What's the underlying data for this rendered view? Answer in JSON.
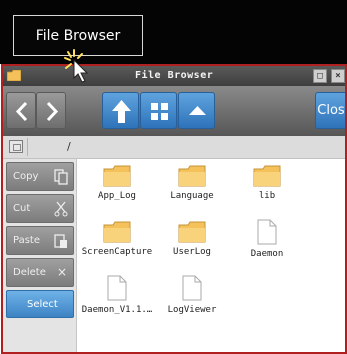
{
  "tooltip": {
    "label": "File Browser"
  },
  "window": {
    "title": "File Browser",
    "minimize_glyph": "□",
    "close_glyph": "×"
  },
  "toolbar": {
    "back_icon": "chevron-left-icon",
    "forward_icon": "chevron-right-icon",
    "up_icon": "arrow-up-icon",
    "view_icon": "grid-view-icon",
    "collapse_icon": "triangle-up-icon",
    "close_label": "Close"
  },
  "path": {
    "value": "/"
  },
  "sidebar": {
    "copy_label": "Copy",
    "cut_label": "Cut",
    "paste_label": "Paste",
    "delete_label": "Delete",
    "delete_glyph": "×",
    "select_label": "Select"
  },
  "files": [
    {
      "name": "App_Log",
      "type": "folder"
    },
    {
      "name": "Language",
      "type": "folder"
    },
    {
      "name": "lib",
      "type": "folder"
    },
    {
      "name": "ScreenCapture",
      "type": "folder"
    },
    {
      "name": "UserLog",
      "type": "folder"
    },
    {
      "name": "Daemon",
      "type": "file"
    },
    {
      "name": "Daemon_V1.1.…",
      "type": "file"
    },
    {
      "name": "LogViewer",
      "type": "file"
    }
  ],
  "colors": {
    "accent_blue": "#3d84c4",
    "window_border": "#b02020",
    "folder": "#f5c15a"
  }
}
